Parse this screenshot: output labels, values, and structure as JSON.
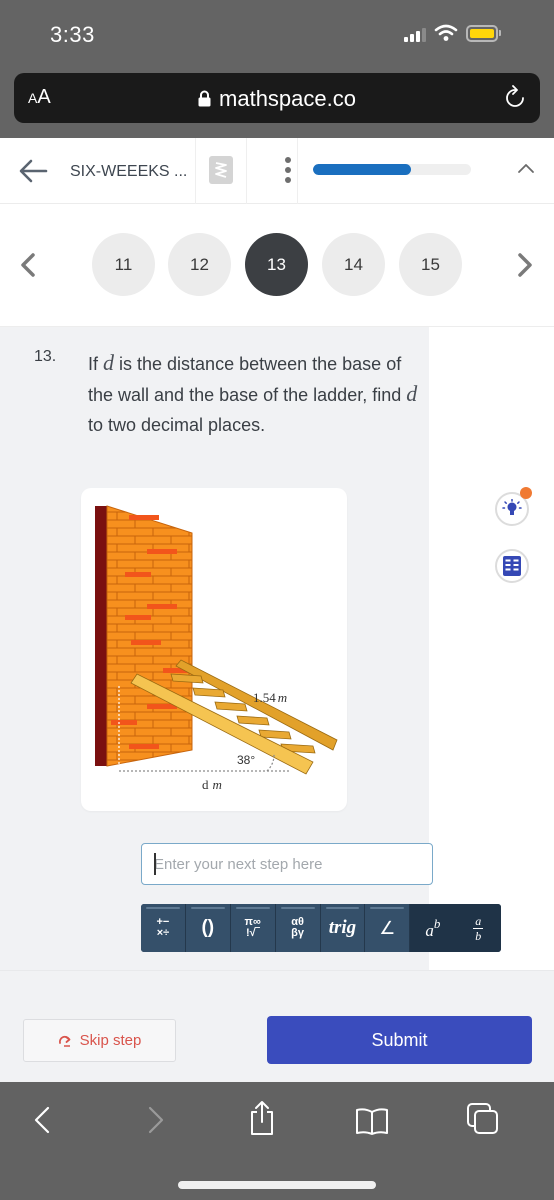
{
  "status_bar": {
    "time": "3:33",
    "icons": [
      "cellular-signal-icon",
      "wifi-icon",
      "battery-icon"
    ],
    "battery_color": "#ffd60a"
  },
  "browser": {
    "text_size_label_small": "A",
    "text_size_label_large": "A",
    "url": "mathspace.co",
    "icons": [
      "lock-icon",
      "reload-icon"
    ]
  },
  "app_header": {
    "course_title": "SIX-WEEEKS ...",
    "progress_fraction": 0.62,
    "progress_color": "#1a6fbf",
    "icons": [
      "back-arrow-icon",
      "mathspace-logo-icon",
      "more-vertical-icon",
      "chevron-up-icon"
    ]
  },
  "question_nav": {
    "items": [
      {
        "label": "11",
        "active": false
      },
      {
        "label": "12",
        "active": false
      },
      {
        "label": "13",
        "active": true
      },
      {
        "label": "14",
        "active": false
      },
      {
        "label": "15",
        "active": false
      }
    ],
    "icons": [
      "chevron-left-icon",
      "chevron-right-icon"
    ]
  },
  "question": {
    "number": "13.",
    "text_parts": {
      "p1": "If ",
      "var1": "d",
      "p2": " is the distance between the base of the wall and the base of the ladder, find ",
      "var2": "d",
      "p3": " to two decimal places."
    },
    "figure": {
      "ladder_length_label": "1.54",
      "ladder_length_unit": "m",
      "angle_label": "38°",
      "distance_label": "d",
      "distance_unit": "m"
    }
  },
  "side_tools": {
    "hint_icon": "lightbulb-icon",
    "hint_badge_color": "#f07a33",
    "notebook_icon": "notebook-icon",
    "accent": "#3548b5"
  },
  "answer": {
    "value": "",
    "placeholder": "Enter your next step here"
  },
  "keypad": {
    "buttons": [
      {
        "name": "operators",
        "line1": "+−",
        "line2": "×÷"
      },
      {
        "name": "brackets",
        "label": "()"
      },
      {
        "name": "constants",
        "line1": "π∞",
        "line2": "!√‾"
      },
      {
        "name": "greek",
        "line1": "αθ",
        "line2": "βγ"
      },
      {
        "name": "trig",
        "label": "trig"
      },
      {
        "name": "angle",
        "label": "∠"
      },
      {
        "name": "power",
        "base": "a",
        "exp": "b"
      },
      {
        "name": "fraction",
        "num": "a",
        "den": "b"
      }
    ]
  },
  "actions": {
    "skip_label": "Skip step",
    "skip_color": "#d9544c",
    "submit_label": "Submit",
    "submit_color": "#3a4cbd"
  },
  "browser_toolbar": {
    "icons": [
      "back-icon",
      "forward-icon",
      "share-icon",
      "bookmarks-icon",
      "tabs-icon"
    ]
  }
}
